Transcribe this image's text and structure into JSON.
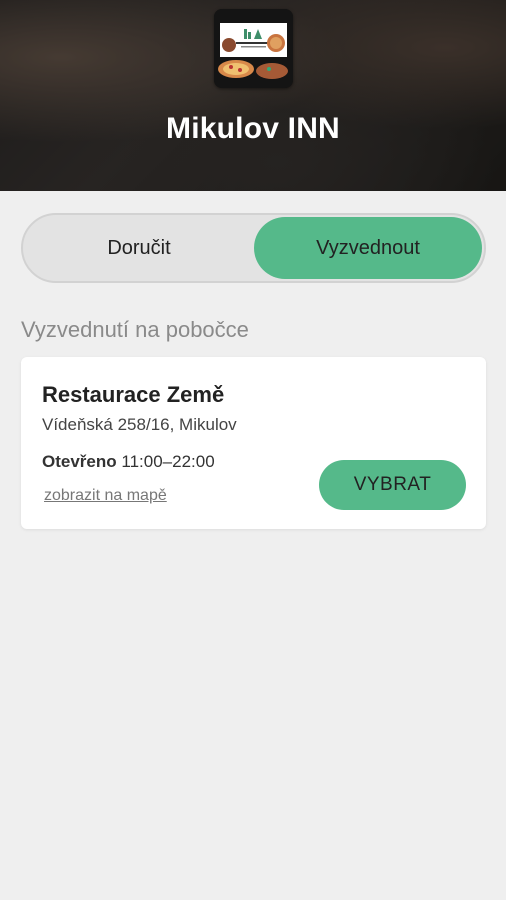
{
  "header": {
    "title": "Mikulov INN",
    "logo_text": "MIKULOV INN"
  },
  "mode_toggle": {
    "options": [
      {
        "label": "Doručit",
        "selected": false
      },
      {
        "label": "Vyzvednout",
        "selected": true
      }
    ]
  },
  "section_title": "Vyzvednutí na pobočce",
  "branch": {
    "name": "Restaurace Země",
    "address": "Vídeňská 258/16, Mikulov",
    "hours_label": "Otevřeno",
    "hours_value": "11:00–22:00",
    "map_link": "zobrazit na mapě",
    "select_label": "VYBRAT"
  },
  "colors": {
    "accent": "#55b98a",
    "background": "#efefef"
  }
}
